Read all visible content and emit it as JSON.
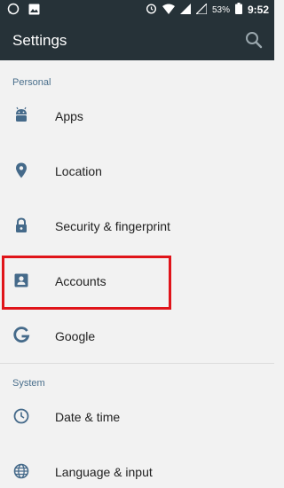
{
  "status_bar": {
    "battery": "53%",
    "time": "9:52"
  },
  "toolbar": {
    "title": "Settings"
  },
  "sections": {
    "personal": "Personal",
    "system": "System"
  },
  "items": [
    {
      "label": "Apps",
      "icon": "android-icon"
    },
    {
      "label": "Location",
      "icon": "location-pin-icon"
    },
    {
      "label": "Security & fingerprint",
      "icon": "lock-icon"
    },
    {
      "label": "Accounts",
      "icon": "account-box-icon"
    },
    {
      "label": "Google",
      "icon": "google-icon"
    },
    {
      "label": "Date & time",
      "icon": "clock-icon"
    },
    {
      "label": "Language & input",
      "icon": "globe-icon"
    }
  ],
  "colors": {
    "toolbar": "#263238",
    "icon": "#456a8a",
    "section_header": "#4a6f8c",
    "highlight": "#e0141a"
  }
}
